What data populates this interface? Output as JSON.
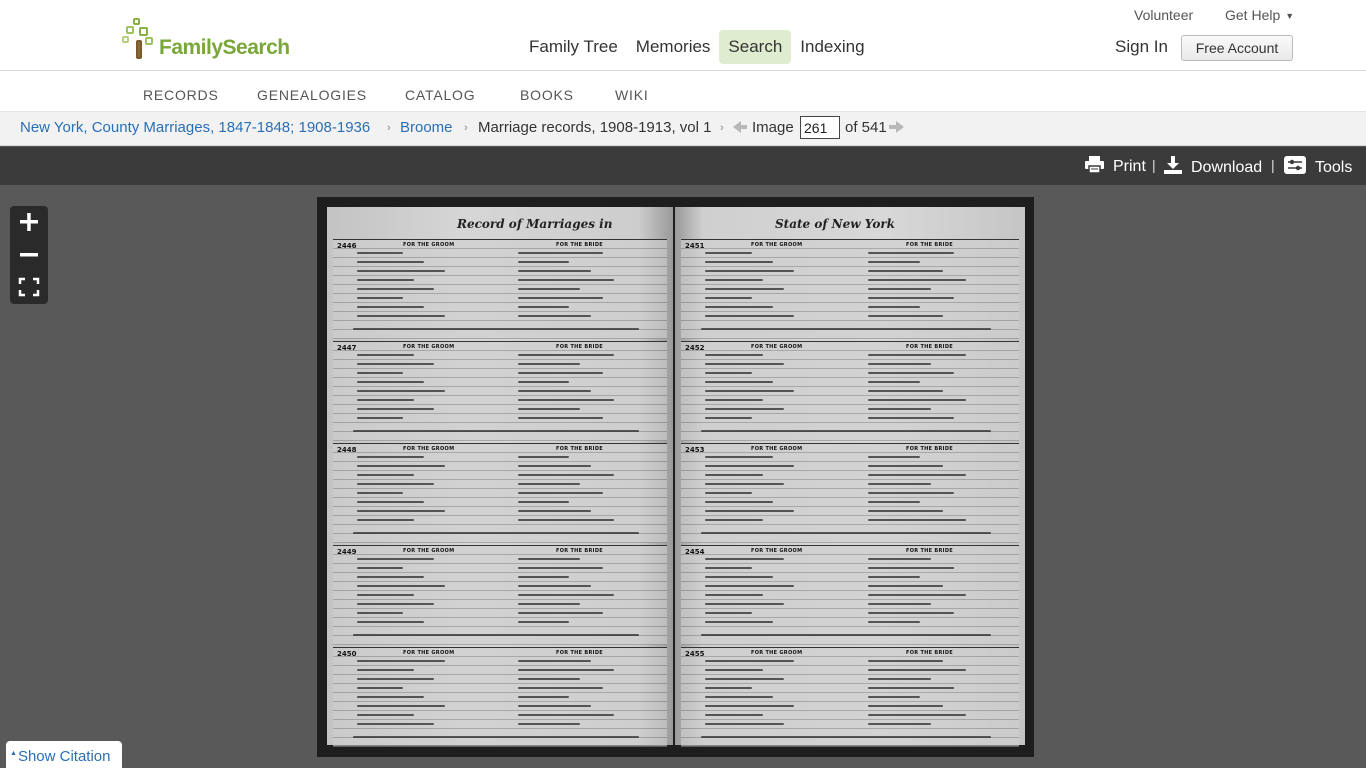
{
  "header": {
    "brand": "FamilySearch",
    "utility": {
      "volunteer": "Volunteer",
      "get_help": "Get Help"
    },
    "nav": [
      "Family Tree",
      "Memories",
      "Search",
      "Indexing"
    ],
    "active_nav": "Search",
    "sign_in": "Sign In",
    "free_account": "Free Account"
  },
  "subnav": [
    "RECORDS",
    "GENEALOGIES",
    "CATALOG",
    "BOOKS",
    "WIKI"
  ],
  "breadcrumb": {
    "collection": "New York, County Marriages, 1847-1848; 1908-1936",
    "county": "Broome",
    "volume": "Marriage records, 1908-1913, vol 1",
    "image_label": "Image",
    "image_number": "261",
    "of_total": "of 541"
  },
  "toolbar": {
    "print": "Print",
    "download": "Download",
    "tools": "Tools",
    "sep": "|"
  },
  "viewer": {
    "left_heading": "Record of Marriages in",
    "right_heading": "State of New York",
    "left_records": [
      "2446",
      "2447",
      "2448",
      "2449",
      "2450"
    ],
    "right_records": [
      "2451",
      "2452",
      "2453",
      "2454",
      "2455"
    ],
    "groom_label": "FOR THE GROOM",
    "bride_label": "FOR THE BRIDE",
    "zoom_in": "+",
    "zoom_out": "−"
  },
  "citation": {
    "label": "Show Citation",
    "caret": "▲"
  },
  "colors": {
    "brand_green": "#7aa73a",
    "link_blue": "#2a6fb5",
    "toolbar_bg": "#3b3b3b",
    "viewer_bg": "#595959",
    "active_nav_bg": "#dfeccf"
  }
}
